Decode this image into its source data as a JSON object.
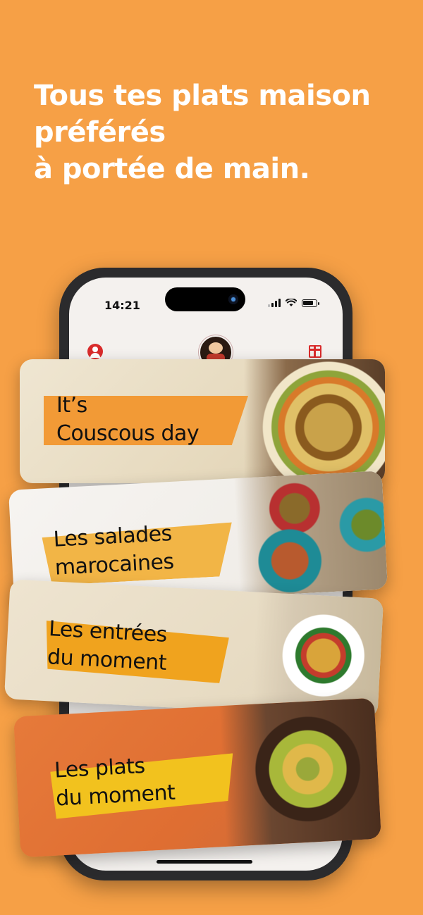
{
  "headline": [
    "Tous tes plats maison",
    "préférés",
    "à portée de main."
  ],
  "status_bar": {
    "time": "14:21"
  },
  "app_header": {
    "profile_icon": "user-icon",
    "gift_icon": "gift-icon",
    "logo": "restaurant-logo"
  },
  "cards": [
    {
      "lines": [
        "It’s",
        "Couscous day"
      ],
      "ribbon_color": "#f29a36"
    },
    {
      "lines": [
        "Les salades",
        "marocaines"
      ],
      "ribbon_color": "#f2b546"
    },
    {
      "lines": [
        "Les entrées",
        "du moment"
      ],
      "ribbon_color": "#f0a31e"
    },
    {
      "lines": [
        "Les plats",
        "du moment"
      ],
      "ribbon_color": "#f2c21e"
    }
  ],
  "colors": {
    "background": "#f6a046",
    "accent_red": "#d92b2b"
  }
}
